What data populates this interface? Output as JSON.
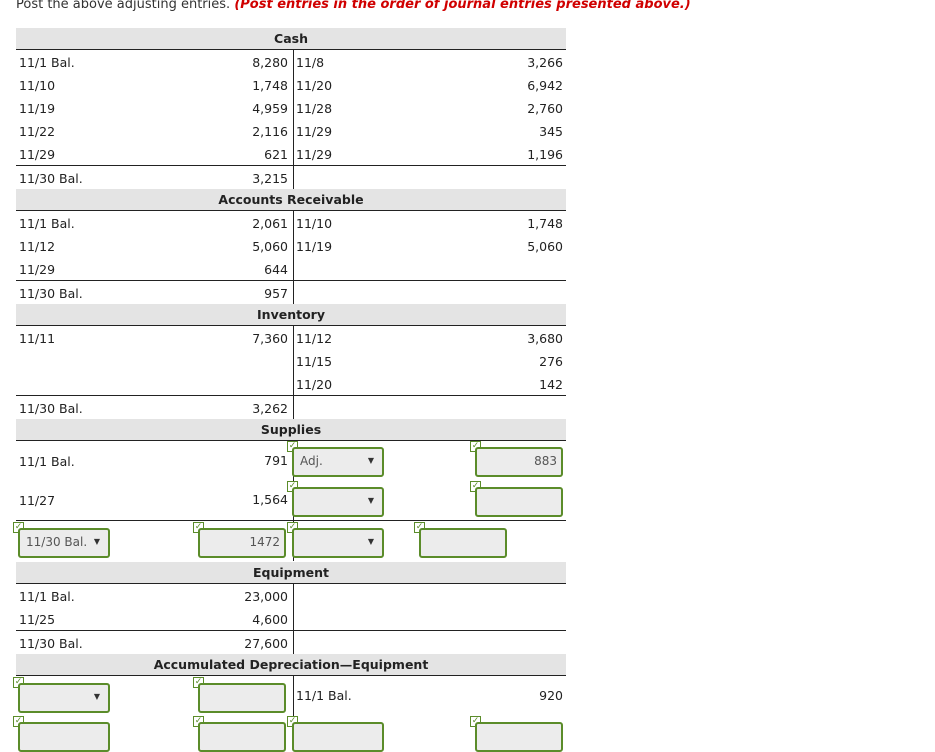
{
  "instructions": {
    "text": "Post the above adjusting entries.",
    "note": "(Post entries in the order of journal entries presented above.)"
  },
  "cash": {
    "title": "Cash",
    "rows": [
      {
        "dl": "11/1 Bal.",
        "da": "8,280",
        "cl": "11/8",
        "ca": "3,266"
      },
      {
        "dl": "11/10",
        "da": "1,748",
        "cl": "11/20",
        "ca": "6,942"
      },
      {
        "dl": "11/19",
        "da": "4,959",
        "cl": "11/28",
        "ca": "2,760"
      },
      {
        "dl": "11/22",
        "da": "2,116",
        "cl": "11/29",
        "ca": "345"
      },
      {
        "dl": "11/29",
        "da": "621",
        "cl": "11/29",
        "ca": "1,196"
      }
    ],
    "bal": {
      "dl": "11/30 Bal.",
      "da": "3,215"
    }
  },
  "ar": {
    "title": "Accounts Receivable",
    "rows": [
      {
        "dl": "11/1 Bal.",
        "da": "2,061",
        "cl": "11/10",
        "ca": "1,748"
      },
      {
        "dl": "11/12",
        "da": "5,060",
        "cl": "11/19",
        "ca": "5,060"
      },
      {
        "dl": "11/29",
        "da": "644",
        "cl": "",
        "ca": ""
      }
    ],
    "bal": {
      "dl": "11/30 Bal.",
      "da": "957"
    }
  },
  "inv": {
    "title": "Inventory",
    "rows": [
      {
        "dl": "11/11",
        "da": "7,360",
        "cl": "11/12",
        "ca": "3,680"
      },
      {
        "dl": "",
        "da": "",
        "cl": "11/15",
        "ca": "276"
      },
      {
        "dl": "",
        "da": "",
        "cl": "11/20",
        "ca": "142"
      }
    ],
    "bal": {
      "dl": "11/30 Bal.",
      "da": "3,262"
    }
  },
  "supplies": {
    "title": "Supplies",
    "r1": {
      "dl": "11/1 Bal.",
      "da": "791",
      "credit_select": "Adj.",
      "credit_amt": "883"
    },
    "r2": {
      "dl": "11/27",
      "da": "1,564"
    },
    "bal": {
      "debit_select": "11/30 Bal.",
      "debit_amt": "1472"
    }
  },
  "equip": {
    "title": "Equipment",
    "rows": [
      {
        "dl": "11/1 Bal.",
        "da": "23,000"
      },
      {
        "dl": "11/25",
        "da": "4,600"
      }
    ],
    "bal": {
      "dl": "11/30 Bal.",
      "da": "27,600"
    }
  },
  "accdep": {
    "title": "Accumulated Depreciation—Equipment",
    "r1": {
      "cl": "11/1 Bal.",
      "ca": "920"
    }
  },
  "colors": {
    "field_border": "#5b8c2a",
    "header_bg": "#e4e4e4",
    "note": "#d00000"
  }
}
